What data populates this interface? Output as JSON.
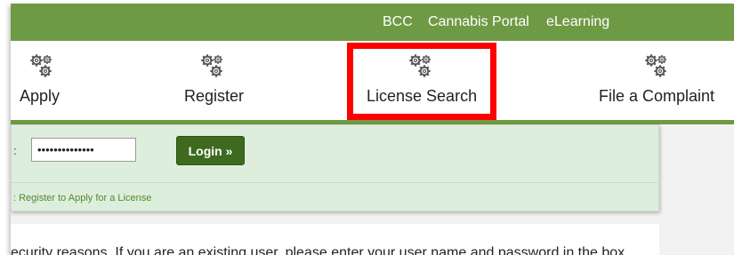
{
  "header": {
    "links": [
      {
        "label": "BCC"
      },
      {
        "label": "Cannabis Portal"
      },
      {
        "label": "eLearning"
      }
    ]
  },
  "nav": {
    "items": [
      {
        "label": "Apply",
        "icon": "gears-icon"
      },
      {
        "label": "Register",
        "icon": "gears-icon"
      },
      {
        "label": "License Search",
        "icon": "gears-icon",
        "highlighted": true
      },
      {
        "label": "File a Complaint",
        "icon": "gears-icon"
      }
    ]
  },
  "login": {
    "field_label_fragment": ":",
    "password_value": "••••••••••••••",
    "login_button": "Login »",
    "register_link": ": Register to Apply for a License"
  },
  "content": {
    "text": "ecurity reasons. If you are an existing user, please enter your user name and password in the box"
  },
  "colors": {
    "header_green": "#6f9a45",
    "login_panel_bg": "#deeedd",
    "login_button": "#3d6a1f",
    "highlight_border": "#ff0000"
  }
}
